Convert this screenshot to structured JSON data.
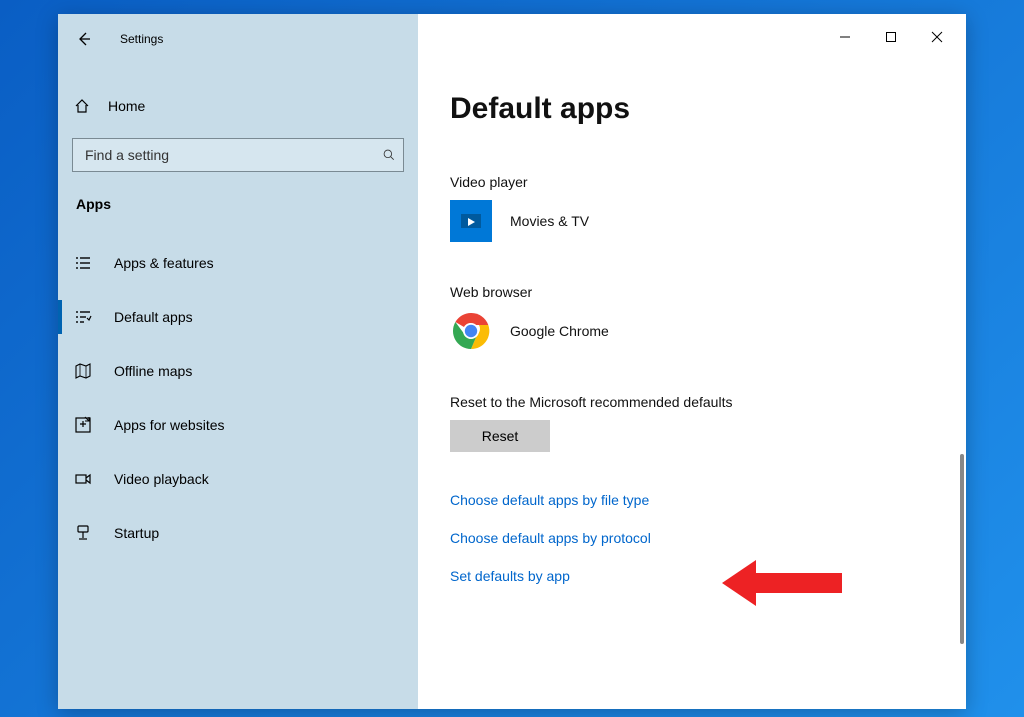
{
  "titlebar": {
    "settings_label": "Settings"
  },
  "sidebar": {
    "home_label": "Home",
    "search_placeholder": "Find a setting",
    "category_label": "Apps",
    "items": [
      {
        "label": "Apps & features"
      },
      {
        "label": "Default apps"
      },
      {
        "label": "Offline maps"
      },
      {
        "label": "Apps for websites"
      },
      {
        "label": "Video playback"
      },
      {
        "label": "Startup"
      }
    ]
  },
  "main": {
    "page_title": "Default apps",
    "video_player_label": "Video player",
    "video_player_app": "Movies & TV",
    "web_browser_label": "Web browser",
    "web_browser_app": "Google Chrome",
    "reset_caption": "Reset to the Microsoft recommended defaults",
    "reset_button": "Reset",
    "links": {
      "by_file_type": "Choose default apps by file type",
      "by_protocol": "Choose default apps by protocol",
      "by_app": "Set defaults by app"
    }
  }
}
